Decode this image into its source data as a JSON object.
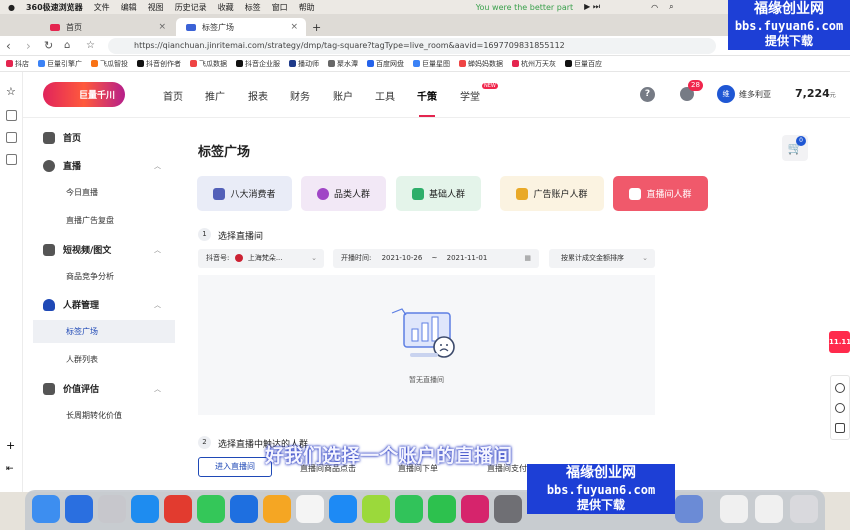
{
  "os_menubar": {
    "items": [
      "360极速浏览器",
      "文件",
      "编辑",
      "视图",
      "历史记录",
      "收藏",
      "标签",
      "窗口",
      "帮助"
    ],
    "now_playing": "You were the better part",
    "status_icons": [
      "play-icon",
      "wifi-icon",
      "search-icon",
      "control-center-icon"
    ]
  },
  "browser": {
    "tabs": [
      {
        "label": "首页",
        "active": false
      },
      {
        "label": "标签广场",
        "active": true
      }
    ],
    "new_tab": "+",
    "url": "https://qianchuan.jinritemai.com/strategy/dmp/tag-square?tagType=live_room&aavid=1697709831855112",
    "bookmarks": [
      "抖店",
      "巨量引擎广",
      "飞瓜智投",
      "抖音创作者",
      "飞瓜数据",
      "抖音企业服",
      "播动师",
      "聚水潭",
      "百度网盘",
      "巨量星图",
      "蝉妈妈数据",
      "杭州万天灰",
      "巨量百应"
    ]
  },
  "header": {
    "logo_text": "巨量千川",
    "nav": [
      "首页",
      "推广",
      "报表",
      "财务",
      "账户",
      "工具",
      "千策",
      "学堂"
    ],
    "nav_selected": "千策",
    "new_badge": "NEW",
    "message_count": "28",
    "avatar_initial": "维",
    "username": "维多利亚",
    "balance": "7,224",
    "balance_unit": "元"
  },
  "sidebar": {
    "home": "首页",
    "groups": [
      {
        "label": "直播",
        "icon": "live-icon",
        "items": [
          "今日直播",
          "直播广告复盘"
        ]
      },
      {
        "label": "短视频/图文",
        "icon": "video-icon",
        "items": [
          "商品竞争分析"
        ]
      },
      {
        "label": "人群管理",
        "icon": "people-icon",
        "items": [
          "标签广场",
          "人群列表"
        ]
      },
      {
        "label": "价值评估",
        "icon": "star-icon",
        "items": [
          "长周期转化价值"
        ]
      }
    ],
    "selected_item": "标签广场"
  },
  "main": {
    "title": "标签广场",
    "cart_count": "0",
    "category_tabs": [
      {
        "label": "八大消费者",
        "bg": "#e9ecf7",
        "icon_color": "#5360b8"
      },
      {
        "label": "品类人群",
        "bg": "#f2e8f6",
        "icon_color": "#a046c6"
      },
      {
        "label": "基础人群",
        "bg": "#e4f4ea",
        "icon_color": "#2eae6a"
      },
      {
        "label": "广告账户人群",
        "bg": "#fbf3e1",
        "icon_color": "#e9a927"
      },
      {
        "label": "直播间人群",
        "bg": "#f0596b",
        "icon_color": "#ffffff"
      }
    ],
    "step1": {
      "num": "1",
      "label": "选择直播间"
    },
    "filters": {
      "douyin_label": "抖音号:",
      "douyin_value": "上海梵朵...",
      "date_label": "开播时间:",
      "date_start": "2021-10-26",
      "date_sep": "~",
      "date_end": "2021-11-01",
      "sort": "按累计成交金额排序"
    },
    "empty_text": "暂无直播间",
    "step2": {
      "num": "2",
      "label": "选择直播中触达的人群"
    },
    "enter_button": "进入直播间",
    "columns": [
      "直播间商品点击",
      "直播间下单",
      "直播间支付"
    ]
  },
  "subtitle": "好我们选择一个账户的直播间",
  "promo": "11.11",
  "watermark": {
    "line1": "福缘创业网",
    "line2": "bbs.fuyuan6.com",
    "line3": "提供下载"
  },
  "colors": {
    "brand_red": "#e4254f",
    "link_blue": "#1f49b6",
    "watermark_blue": "#1d3fd6"
  }
}
